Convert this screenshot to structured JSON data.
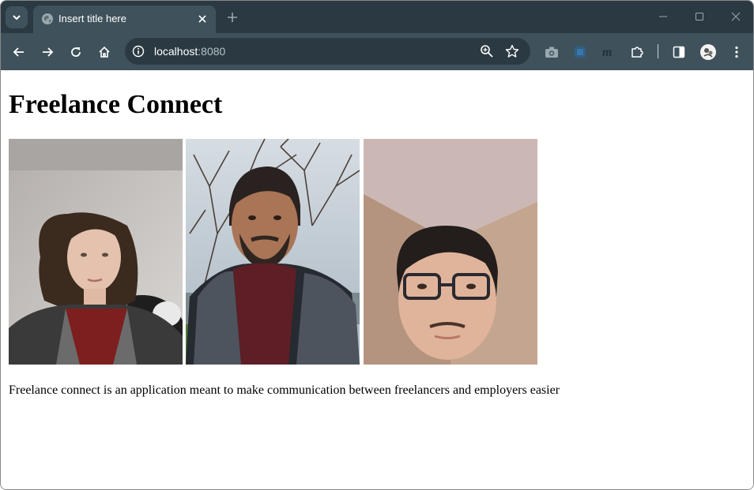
{
  "browser": {
    "tab_title": "Insert title here",
    "url_host": "localhost",
    "url_port": ":8080",
    "accent_dark": "#2b3a42",
    "accent_mid": "#3f525c",
    "icons": [
      "tab-search-icon",
      "globe-icon",
      "close-icon",
      "plus-icon",
      "minimize-icon",
      "maximize-icon",
      "window-close-icon",
      "back-arrow-icon",
      "forward-arrow-icon",
      "reload-icon",
      "home-icon",
      "info-icon",
      "zoom-icon",
      "star-icon",
      "camera-extension-icon",
      "blue-extension-icon",
      "m-extension-icon",
      "puzzle-extensions-icon",
      "side-panel-icon",
      "profile-avatar-icon",
      "kebab-menu-icon"
    ]
  },
  "page": {
    "title": "Freelance Connect",
    "photos": [
      {
        "name": "person-photo-1"
      },
      {
        "name": "person-photo-2"
      },
      {
        "name": "person-photo-3"
      }
    ],
    "description": "Freelance connect is an application meant to make communication between freelancers and employers easier"
  }
}
